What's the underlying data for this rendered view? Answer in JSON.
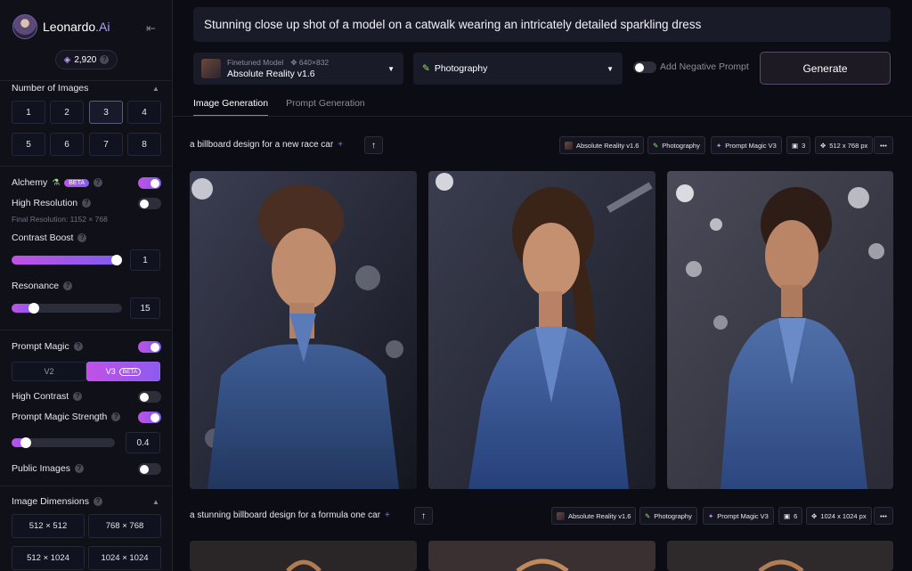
{
  "app": {
    "name_main": "Leonardo",
    "name_suffix": ".Ai",
    "tokens": "2,920"
  },
  "sidebar": {
    "num_images_label": "Number of Images",
    "num_options": [
      "1",
      "2",
      "3",
      "4",
      "5",
      "6",
      "7",
      "8"
    ],
    "num_selected": "3",
    "alchemy_label": "Alchemy",
    "beta": "BETA",
    "high_res_label": "High Resolution",
    "final_res": "Final Resolution: 1152 × 768",
    "contrast_boost_label": "Contrast Boost",
    "contrast_boost_value": "1",
    "contrast_boost_fraction": 1.0,
    "resonance_label": "Resonance",
    "resonance_value": "15",
    "resonance_fraction": 0.17,
    "prompt_magic_label": "Prompt Magic",
    "pm_versions": [
      "V2",
      "V3"
    ],
    "high_contrast_label": "High Contrast",
    "pm_strength_label": "Prompt Magic Strength",
    "pm_strength_value": "0.4",
    "pm_strength_fraction": 0.1,
    "public_images_label": "Public Images",
    "image_dimensions_label": "Image Dimensions",
    "dimensions": [
      "512 × 512",
      "768 × 768",
      "512 × 1024",
      "1024 × 1024"
    ]
  },
  "top": {
    "prompt": "Stunning close up shot of a model on a catwalk wearing an intricately detailed sparkling dress",
    "model_kind": "Finetuned Model",
    "model_res": "640×832",
    "model_name": "Absolute Reality v1.6",
    "style": "Photography",
    "negative_prompt_label": "Add Negative Prompt",
    "generate_label": "Generate"
  },
  "tabs": [
    "Image Generation",
    "Prompt Generation"
  ],
  "generations": [
    {
      "prompt": "a billboard design for a new race car",
      "model": "Absolute Reality v1.6",
      "style": "Photography",
      "magic": "Prompt Magic V3",
      "count": "3",
      "size": "512 x 768 px"
    },
    {
      "prompt": "a stunning billboard design for a formula one car",
      "model": "Absolute Reality v1.6",
      "style": "Photography",
      "magic": "Prompt Magic V3",
      "count": "6",
      "size": "1024 x 1024 px"
    }
  ],
  "colors": {
    "accent_start": "#c251e6",
    "accent_end": "#7f5cf0",
    "background": "#0c0d14"
  }
}
